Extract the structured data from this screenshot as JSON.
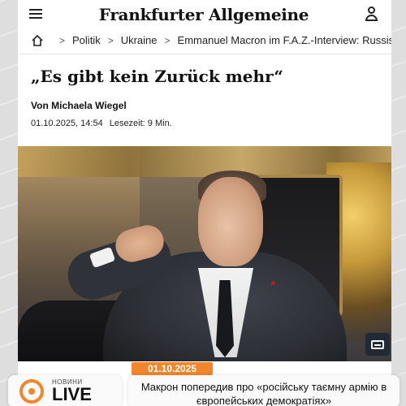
{
  "header": {
    "logo": "Frankfurter Allgemeine"
  },
  "breadcrumb": {
    "items": [
      "Politik",
      "Ukraine",
      "Emmanuel Macron im F.A.Z.-Interview: Russische"
    ]
  },
  "article": {
    "headline": "„Es gibt kein Zurück mehr“",
    "author": "Von Michaela Wiegel",
    "date": "01.10.2025, 14:54",
    "read_time": "Lesezeit: 9 Min."
  },
  "overlay": {
    "date": "01.10.2025",
    "channel_small": "НОВИНИ",
    "channel_big": "LIVE",
    "news_text": "Макрон попередив про «російську таємну армію в європейських демократіях»"
  },
  "colors": {
    "accent": "#f3852a"
  }
}
